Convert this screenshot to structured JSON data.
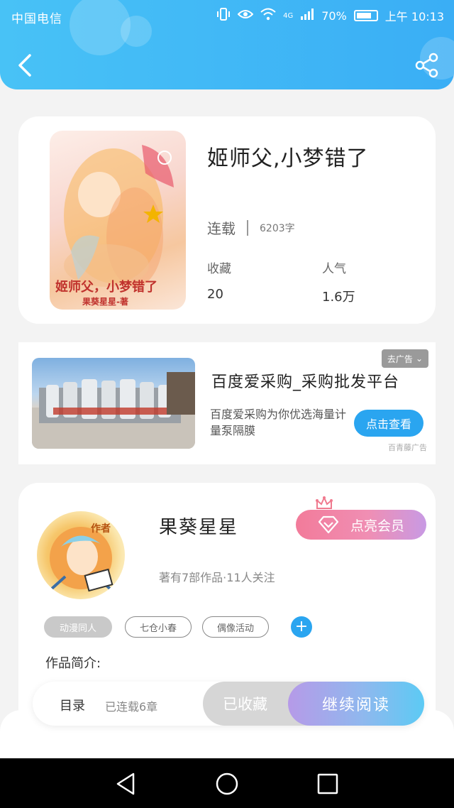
{
  "status_bar": {
    "carrier": "中国电信",
    "network": "4G",
    "battery": "70%",
    "time": "上午 10:13"
  },
  "header": {
    "back_icon": "chevron-left-icon",
    "share_icon": "share-icon"
  },
  "book": {
    "title": "姬师父,小梦错了",
    "cover_title": "姬师父，小梦错了",
    "cover_author": "果葵星星-著",
    "status": "连载",
    "word_count": "6203字",
    "favorites_label": "收藏",
    "favorites_value": "20",
    "popularity_label": "人气",
    "popularity_value": "1.6万"
  },
  "ad": {
    "close_label": "去广告",
    "title": "百度爱采购_采购批发平台",
    "description": "百度爱采购为你优选海量计量泵隔膜",
    "button_label": "点击查看",
    "source": "百青藤广告"
  },
  "author": {
    "avatar_badge": "作者",
    "name": "果葵星星",
    "meta": "著有7部作品·11人关注",
    "vip_button": "点亮会员",
    "tags": [
      "动漫同人",
      "七仓小春",
      "偶像活动"
    ],
    "add_tag": "+",
    "intro_label": "作品简介:"
  },
  "action_bar": {
    "toc_label": "目录",
    "chapters": "已连载6章",
    "collected_label": "已收藏",
    "continue_label": "继续阅读"
  },
  "colors": {
    "header_start": "#48c2f6",
    "accent_blue": "#2aa5f0",
    "vip_pink": "#f27b9a"
  }
}
